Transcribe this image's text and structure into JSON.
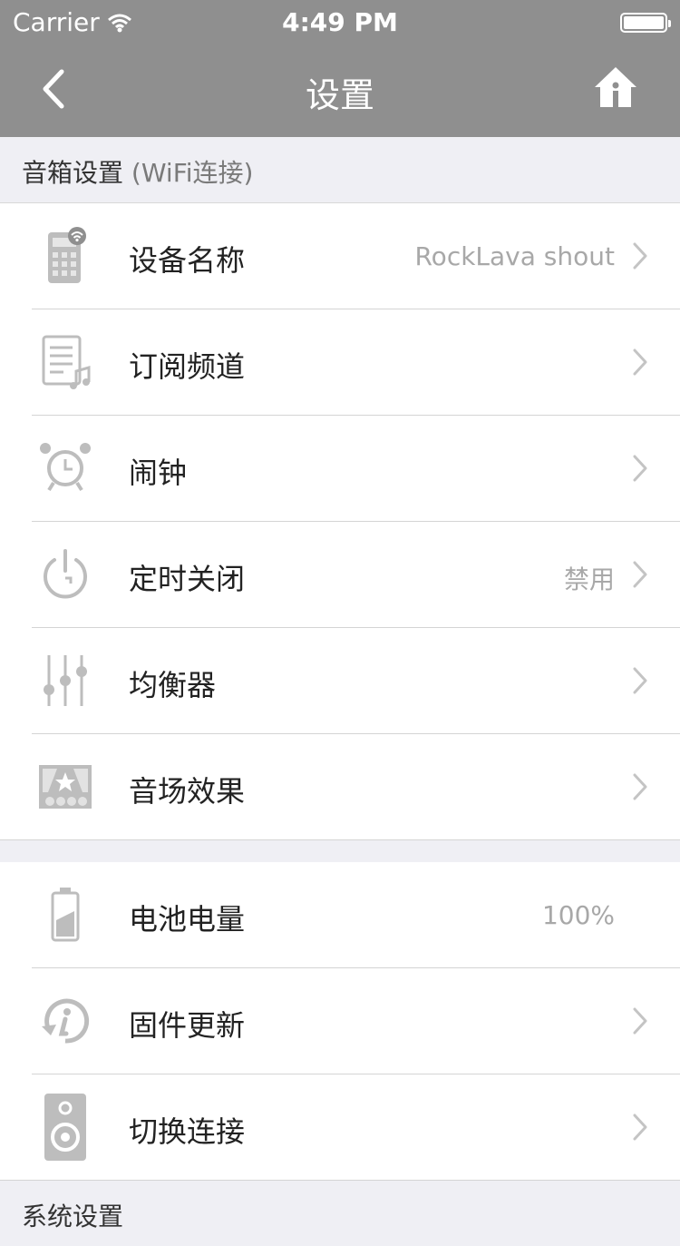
{
  "status": {
    "carrier": "Carrier",
    "time": "4:49 PM"
  },
  "nav": {
    "title": "设置"
  },
  "section1": {
    "title": "音箱设置",
    "subtitle": "(WiFi连接)"
  },
  "rows1": [
    {
      "label": "设备名称",
      "value": "RockLava shout",
      "icon": "device-wifi-icon"
    },
    {
      "label": "订阅频道",
      "value": "",
      "icon": "music-document-icon"
    },
    {
      "label": "闹钟",
      "value": "",
      "icon": "alarm-clock-icon"
    },
    {
      "label": "定时关闭",
      "value": "禁用",
      "icon": "power-timer-icon"
    },
    {
      "label": "均衡器",
      "value": "",
      "icon": "equalizer-icon"
    },
    {
      "label": "音场效果",
      "value": "",
      "icon": "theater-icon"
    }
  ],
  "rows2": [
    {
      "label": "电池电量",
      "value": "100%",
      "icon": "battery-icon"
    },
    {
      "label": "固件更新",
      "value": "",
      "icon": "firmware-update-icon"
    },
    {
      "label": "切换连接",
      "value": "",
      "icon": "speaker-icon"
    }
  ],
  "section2": {
    "title": "系统设置"
  }
}
